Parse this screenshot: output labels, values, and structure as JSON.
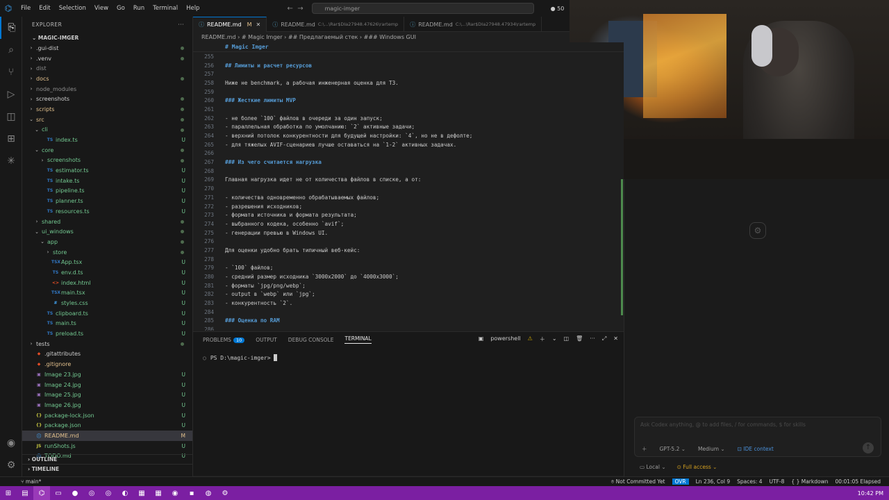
{
  "menu": [
    "File",
    "Edit",
    "Selection",
    "View",
    "Go",
    "Run",
    "Terminal",
    "Help"
  ],
  "search": {
    "text": "magic-imger"
  },
  "notification_count": "50",
  "activity": [
    {
      "icon": "files-icon",
      "glyph": "⎘"
    },
    {
      "icon": "search-icon",
      "glyph": "⌕"
    },
    {
      "icon": "source-control-icon",
      "glyph": "⑂"
    },
    {
      "icon": "run-debug-icon",
      "glyph": "▷"
    },
    {
      "icon": "remote-icon",
      "glyph": "◫"
    },
    {
      "icon": "extensions-icon",
      "glyph": "⊞"
    },
    {
      "icon": "copilot-icon",
      "glyph": "✳"
    }
  ],
  "sidebar": {
    "title": "EXPLORER",
    "root": "MAGIC-IMGER",
    "items": [
      {
        "label": ".gui-dist",
        "indent": 0,
        "arrow": "›",
        "icon": "",
        "badge": "",
        "color": "#cccccc",
        "dot": true
      },
      {
        "label": ".venv",
        "indent": 0,
        "arrow": "›",
        "icon": "",
        "badge": "",
        "color": "#cccccc",
        "dot": true
      },
      {
        "label": "dist",
        "indent": 0,
        "arrow": "›",
        "icon": "",
        "badge": "",
        "color": "#8c8c8c",
        "dot": false
      },
      {
        "label": "docs",
        "indent": 0,
        "arrow": "›",
        "icon": "",
        "badge": "",
        "color": "#e2c08d",
        "dot": true
      },
      {
        "label": "node_modules",
        "indent": 0,
        "arrow": "›",
        "icon": "",
        "badge": "",
        "color": "#8c8c8c",
        "dot": false
      },
      {
        "label": "screenshots",
        "indent": 0,
        "arrow": "›",
        "icon": "",
        "badge": "",
        "color": "#cccccc",
        "dot": true
      },
      {
        "label": "scripts",
        "indent": 0,
        "arrow": "›",
        "icon": "",
        "badge": "",
        "color": "#e2c08d",
        "dot": true
      },
      {
        "label": "src",
        "indent": 0,
        "arrow": "⌄",
        "icon": "",
        "badge": "",
        "color": "#e2c08d",
        "dot": true
      },
      {
        "label": "cli",
        "indent": 1,
        "arrow": "⌄",
        "icon": "",
        "badge": "",
        "color": "#73c991",
        "dot": true
      },
      {
        "label": "index.ts",
        "indent": 2,
        "arrow": "",
        "icon": "TS",
        "badge": "U",
        "color": "#73c991",
        "dot": false
      },
      {
        "label": "core",
        "indent": 1,
        "arrow": "⌄",
        "icon": "",
        "badge": "",
        "color": "#73c991",
        "dot": true
      },
      {
        "label": "screenshots",
        "indent": 2,
        "arrow": "›",
        "icon": "",
        "badge": "",
        "color": "#73c991",
        "dot": true
      },
      {
        "label": "estimator.ts",
        "indent": 2,
        "arrow": "",
        "icon": "TS",
        "badge": "U",
        "color": "#73c991",
        "dot": false
      },
      {
        "label": "intake.ts",
        "indent": 2,
        "arrow": "",
        "icon": "TS",
        "badge": "U",
        "color": "#73c991",
        "dot": false
      },
      {
        "label": "pipeline.ts",
        "indent": 2,
        "arrow": "",
        "icon": "TS",
        "badge": "U",
        "color": "#73c991",
        "dot": false
      },
      {
        "label": "planner.ts",
        "indent": 2,
        "arrow": "",
        "icon": "TS",
        "badge": "U",
        "color": "#73c991",
        "dot": false
      },
      {
        "label": "resources.ts",
        "indent": 2,
        "arrow": "",
        "icon": "TS",
        "badge": "U",
        "color": "#73c991",
        "dot": false
      },
      {
        "label": "shared",
        "indent": 1,
        "arrow": "›",
        "icon": "",
        "badge": "",
        "color": "#73c991",
        "dot": true
      },
      {
        "label": "ui_windows",
        "indent": 1,
        "arrow": "⌄",
        "icon": "",
        "badge": "",
        "color": "#73c991",
        "dot": true
      },
      {
        "label": "app",
        "indent": 2,
        "arrow": "⌄",
        "icon": "",
        "badge": "",
        "color": "#73c991",
        "dot": true
      },
      {
        "label": "store",
        "indent": 3,
        "arrow": "›",
        "icon": "",
        "badge": "",
        "color": "#73c991",
        "dot": true
      },
      {
        "label": "App.tsx",
        "indent": 3,
        "arrow": "",
        "icon": "TSX",
        "badge": "U",
        "color": "#73c991",
        "dot": false
      },
      {
        "label": "env.d.ts",
        "indent": 3,
        "arrow": "",
        "icon": "TS",
        "badge": "U",
        "color": "#73c991",
        "dot": false
      },
      {
        "label": "index.html",
        "indent": 3,
        "arrow": "",
        "icon": "<>",
        "badge": "U",
        "color": "#73c991",
        "dot": false
      },
      {
        "label": "main.tsx",
        "indent": 3,
        "arrow": "",
        "icon": "TSX",
        "badge": "U",
        "color": "#73c991",
        "dot": false
      },
      {
        "label": "styles.css",
        "indent": 3,
        "arrow": "",
        "icon": "#",
        "badge": "U",
        "color": "#73c991",
        "dot": false
      },
      {
        "label": "clipboard.ts",
        "indent": 2,
        "arrow": "",
        "icon": "TS",
        "badge": "U",
        "color": "#73c991",
        "dot": false
      },
      {
        "label": "main.ts",
        "indent": 2,
        "arrow": "",
        "icon": "TS",
        "badge": "U",
        "color": "#73c991",
        "dot": false
      },
      {
        "label": "preload.ts",
        "indent": 2,
        "arrow": "",
        "icon": "TS",
        "badge": "U",
        "color": "#73c991",
        "dot": false
      },
      {
        "label": "tests",
        "indent": 0,
        "arrow": "›",
        "icon": "",
        "badge": "",
        "color": "#cccccc",
        "dot": true
      },
      {
        "label": ".gitattributes",
        "indent": 0,
        "arrow": "",
        "icon": "◆",
        "badge": "",
        "color": "#cccccc",
        "dot": false
      },
      {
        "label": ".gitignore",
        "indent": 0,
        "arrow": "",
        "icon": "◆",
        "badge": "",
        "color": "#e2c08d",
        "dot": false
      },
      {
        "label": "Image 23.jpg",
        "indent": 0,
        "arrow": "",
        "icon": "▣",
        "badge": "U",
        "color": "#73c991",
        "dot": false
      },
      {
        "label": "Image 24.jpg",
        "indent": 0,
        "arrow": "",
        "icon": "▣",
        "badge": "U",
        "color": "#73c991",
        "dot": false
      },
      {
        "label": "Image 25.jpg",
        "indent": 0,
        "arrow": "",
        "icon": "▣",
        "badge": "U",
        "color": "#73c991",
        "dot": false
      },
      {
        "label": "Image 26.jpg",
        "indent": 0,
        "arrow": "",
        "icon": "▣",
        "badge": "U",
        "color": "#73c991",
        "dot": false
      },
      {
        "label": "package-lock.json",
        "indent": 0,
        "arrow": "",
        "icon": "{}",
        "badge": "U",
        "color": "#73c991",
        "dot": false
      },
      {
        "label": "package.json",
        "indent": 0,
        "arrow": "",
        "icon": "{}",
        "badge": "U",
        "color": "#73c991",
        "dot": false
      },
      {
        "label": "README.md",
        "indent": 0,
        "arrow": "",
        "icon": "ⓘ",
        "badge": "M",
        "color": "#e2c08d",
        "dot": false,
        "selected": true
      },
      {
        "label": "runShots.js",
        "indent": 0,
        "arrow": "",
        "icon": "JS",
        "badge": "U",
        "color": "#73c991",
        "dot": false
      },
      {
        "label": "TODO.md",
        "indent": 0,
        "arrow": "",
        "icon": "ⓘ",
        "badge": "U",
        "color": "#73c991",
        "dot": false
      }
    ],
    "outline": "OUTLINE",
    "timeline": "TIMELINE"
  },
  "tabs": [
    {
      "label": "README.md",
      "path": "",
      "suffix": "M",
      "active": true
    },
    {
      "label": "README.md",
      "path": "C:\\...\\Rar$DIa27948.47626\\rartemp",
      "suffix": "",
      "active": false
    },
    {
      "label": "README.md",
      "path": "C:\\...\\Rar$DIa27948.47934\\rartemp",
      "suffix": "",
      "active": false
    }
  ],
  "breadcrumb": "README.md  ›  # Magic Imger  ›  ## Предлагаемый стек  ›  ### Windows GUI",
  "sticky_heading": "# Magic Imger",
  "code": [
    {
      "n": "255",
      "t": "",
      "k": ""
    },
    {
      "n": "256",
      "t": "## Лимиты и расчет ресурсов",
      "k": "h"
    },
    {
      "n": "257",
      "t": "",
      "k": ""
    },
    {
      "n": "258",
      "t": "Ниже не benchmark, а рабочая инженерная оценка для ТЗ.",
      "k": ""
    },
    {
      "n": "259",
      "t": "",
      "k": ""
    },
    {
      "n": "260",
      "t": "### Жесткие лимиты MVP",
      "k": "h"
    },
    {
      "n": "261",
      "t": "",
      "k": ""
    },
    {
      "n": "262",
      "t": "- не более `100` файлов в очереди за один запуск;",
      "k": ""
    },
    {
      "n": "263",
      "t": "- параллельная обработка по умолчанию: `2` активные задачи;",
      "k": ""
    },
    {
      "n": "264",
      "t": "- верхний потолок конкурентности для будущей настройки: `4`, но не в дефолте;",
      "k": ""
    },
    {
      "n": "265",
      "t": "- для тяжелых AVIF-сценариев лучше оставаться на `1-2` активных задачах.",
      "k": ""
    },
    {
      "n": "266",
      "t": "",
      "k": ""
    },
    {
      "n": "267",
      "t": "### Из чего считается нагрузка",
      "k": "h"
    },
    {
      "n": "268",
      "t": "",
      "k": ""
    },
    {
      "n": "269",
      "t": "Главная нагрузка идет не от количества файлов в списке, а от:",
      "k": ""
    },
    {
      "n": "270",
      "t": "",
      "k": ""
    },
    {
      "n": "271",
      "t": "- количества одновременно обрабатываемых файлов;",
      "k": ""
    },
    {
      "n": "272",
      "t": "- разрешения исходников;",
      "k": ""
    },
    {
      "n": "273",
      "t": "- формата источника и формата результата;",
      "k": ""
    },
    {
      "n": "274",
      "t": "- выбранного кодека, особенно `avif`;",
      "k": ""
    },
    {
      "n": "275",
      "t": "- генерации превью в Windows UI.",
      "k": ""
    },
    {
      "n": "276",
      "t": "",
      "k": ""
    },
    {
      "n": "277",
      "t": "Для оценки удобно брать типичный веб-кейс:",
      "k": ""
    },
    {
      "n": "278",
      "t": "",
      "k": ""
    },
    {
      "n": "279",
      "t": "- `100` файлов;",
      "k": ""
    },
    {
      "n": "280",
      "t": "- средний размер исходника `3000x2000` до `4000x3000`;",
      "k": ""
    },
    {
      "n": "281",
      "t": "- форматы `jpg/png/webp`;",
      "k": ""
    },
    {
      "n": "282",
      "t": "- output в `webp` или `jpg`;",
      "k": ""
    },
    {
      "n": "283",
      "t": "- конкурентность `2`.",
      "k": ""
    },
    {
      "n": "284",
      "t": "",
      "k": ""
    },
    {
      "n": "285",
      "t": "### Оценка по RAM",
      "k": "h"
    },
    {
      "n": "286",
      "t": "",
      "k": ""
    }
  ],
  "panel": {
    "tabs": [
      "PROBLEMS",
      "OUTPUT",
      "DEBUG CONSOLE",
      "TERMINAL"
    ],
    "problems_count": "10",
    "shell": "powershell",
    "prompt": "PS D:\\magic-imger>"
  },
  "chat": {
    "placeholder": "Ask Codex anything, @ to add files, / for commands, $ for skills",
    "model": "GPT-5.2",
    "effort": "Medium",
    "context": "IDE context",
    "env": "Local",
    "access": "Full access"
  },
  "status": {
    "branch": "main*",
    "commit": "Not Committed Yet",
    "ovr": "OVR",
    "position": "Ln 236, Col 9",
    "spaces": "Spaces: 4",
    "encoding": "UTF-8",
    "language": "Markdown",
    "elapsed": "00:01:05 Elapsed"
  },
  "taskbar": {
    "clock": "10:42 PM",
    "apps": [
      "windows-start",
      "file-explorer",
      "vscode",
      "folder",
      "app-blue",
      "chrome-1",
      "chrome-2",
      "app-cyan",
      "app-red",
      "app-green",
      "app-obs",
      "app-orange",
      "app-github",
      "app-settings"
    ]
  }
}
